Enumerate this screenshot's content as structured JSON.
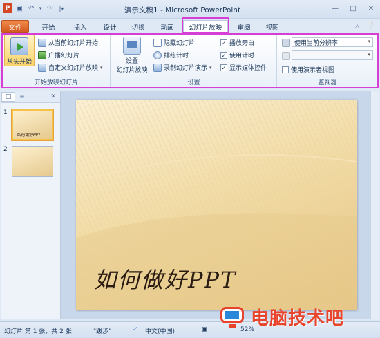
{
  "window": {
    "title": "演示文稿1 - Microsoft PowerPoint",
    "app_letter": "P"
  },
  "tabs": [
    {
      "label": "文件"
    },
    {
      "label": "开始"
    },
    {
      "label": "插入"
    },
    {
      "label": "设计"
    },
    {
      "label": "切换"
    },
    {
      "label": "动画"
    },
    {
      "label": "幻灯片放映"
    },
    {
      "label": "审阅"
    },
    {
      "label": "视图"
    }
  ],
  "ribbon": {
    "start_group": {
      "label": "开始放映幻灯片",
      "from_start": "从头开始",
      "from_current": "从当前幻灯片开始",
      "broadcast": "广播幻灯片",
      "custom": "自定义幻灯片放映"
    },
    "setup_group": {
      "label": "设置",
      "setup_button_line1": "设置",
      "setup_button_line2": "幻灯片放映",
      "hide_slide": "隐藏幻灯片",
      "rehearse": "排练计时",
      "record": "录制幻灯片演示",
      "play_narration": "播放旁白",
      "use_timings": "使用计时",
      "show_media": "显示媒体控件"
    },
    "monitor_group": {
      "label": "监视器",
      "resolution_value": "使用当前分辨率",
      "monitor_value": "",
      "presenter_view": "使用演示者视图"
    }
  },
  "thumbnails": [
    {
      "number": "1",
      "caption": "如何做好PPT"
    },
    {
      "number": "2",
      "caption": ""
    }
  ],
  "slide": {
    "title": "如何做好PPT"
  },
  "statusbar": {
    "slide_info": "幻灯片 第 1 张，共 2 张",
    "theme": "\"跋涉\"",
    "language": "中文(中国)",
    "zoom": "52%"
  },
  "watermark": {
    "text": "电脑技术吧"
  },
  "colors": {
    "accent_file_tab": "#d2581d",
    "highlight": "#d63fd6",
    "watermark": "#e8442c"
  }
}
